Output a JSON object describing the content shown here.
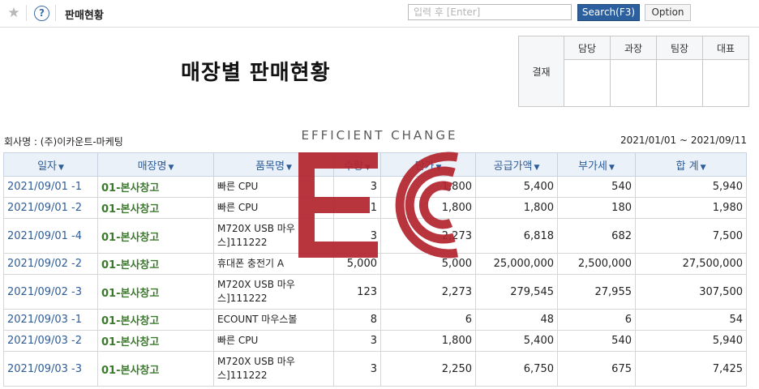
{
  "topbar": {
    "star_icon": "star-icon",
    "help_icon": "help-icon",
    "help_glyph": "?",
    "page_title": "판매현황",
    "search_placeholder": "입력 후 [Enter]",
    "search_button": "Search(F3)",
    "option_button": "Option"
  },
  "report": {
    "title": "매장별 판매현황",
    "company": "회사명 : (주)이카운트-마케팅",
    "period": "2021/01/01 ~ 2021/09/11"
  },
  "approval": {
    "label": "결재",
    "roles": [
      "담당",
      "과장",
      "팀장",
      "대표"
    ]
  },
  "watermark": {
    "text": "EFFICIENT CHANGE",
    "logo": "ec-logo",
    "color": "#b3242e"
  },
  "table": {
    "columns": [
      "일자",
      "매장명",
      "품목명",
      "수량",
      "단가",
      "공급가액",
      "부가세",
      "합 계"
    ],
    "rows": [
      {
        "date": "2021/09/01 -1",
        "store": "01-본사창고",
        "product": "빠른 CPU",
        "qty": "3",
        "price": "1,800",
        "supply": "5,400",
        "vat": "540",
        "total": "5,940"
      },
      {
        "date": "2021/09/01 -2",
        "store": "01-본사창고",
        "product": "빠른 CPU",
        "qty": "1",
        "price": "1,800",
        "supply": "1,800",
        "vat": "180",
        "total": "1,980"
      },
      {
        "date": "2021/09/01 -4",
        "store": "01-본사창고",
        "product": "M720X USB 마우스]111222",
        "qty": "3",
        "price": "2,273",
        "supply": "6,818",
        "vat": "682",
        "total": "7,500"
      },
      {
        "date": "2021/09/02 -2",
        "store": "01-본사창고",
        "product": "휴대폰 충전기 A",
        "qty": "5,000",
        "price": "5,000",
        "supply": "25,000,000",
        "vat": "2,500,000",
        "total": "27,500,000"
      },
      {
        "date": "2021/09/02 -3",
        "store": "01-본사창고",
        "product": "M720X USB 마우스]111222",
        "qty": "123",
        "price": "2,273",
        "supply": "279,545",
        "vat": "27,955",
        "total": "307,500"
      },
      {
        "date": "2021/09/03 -1",
        "store": "01-본사창고",
        "product": "ECOUNT 마우스볼",
        "qty": "8",
        "price": "6",
        "supply": "48",
        "vat": "6",
        "total": "54"
      },
      {
        "date": "2021/09/03 -2",
        "store": "01-본사창고",
        "product": "빠른 CPU",
        "qty": "3",
        "price": "1,800",
        "supply": "5,400",
        "vat": "540",
        "total": "5,940"
      },
      {
        "date": "2021/09/03 -3",
        "store": "01-본사창고",
        "product": "M720X USB 마우스]111222",
        "qty": "3",
        "price": "2,250",
        "supply": "6,750",
        "vat": "675",
        "total": "7,425"
      }
    ]
  }
}
